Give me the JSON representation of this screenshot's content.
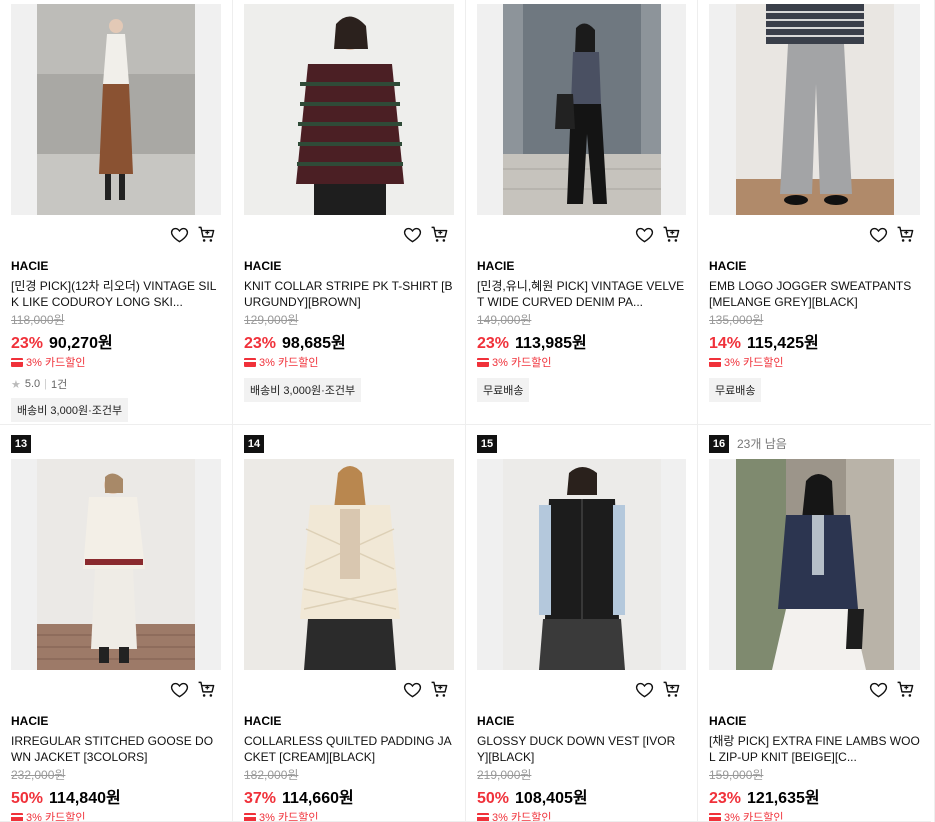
{
  "products": [
    {
      "rank": "",
      "remaining": "",
      "brand": "HACIE",
      "title": "[민경 PICK](12차 리오더) VINTAGE SILK LIKE CODUROY LONG SKI...",
      "original_price": "118,000원",
      "discount": "23%",
      "price": "90,270원",
      "card_discount": "3% 카드할인",
      "rating": "5.0",
      "reviews": "1건",
      "shipping": "배송비 3,000원·조건부"
    },
    {
      "rank": "",
      "remaining": "",
      "brand": "HACIE",
      "title": "KNIT COLLAR STRIPE PK T-SHIRT [BURGUNDY][BROWN]",
      "original_price": "129,000원",
      "discount": "23%",
      "price": "98,685원",
      "card_discount": "3% 카드할인",
      "rating": "",
      "reviews": "",
      "shipping": "배송비 3,000원·조건부"
    },
    {
      "rank": "",
      "remaining": "",
      "brand": "HACIE",
      "title": "[민경,유니,혜원 PICK] VINTAGE VELVET WIDE CURVED DENIM PA...",
      "original_price": "149,000원",
      "discount": "23%",
      "price": "113,985원",
      "card_discount": "3% 카드할인",
      "rating": "",
      "reviews": "",
      "shipping": "무료배송"
    },
    {
      "rank": "",
      "remaining": "",
      "brand": "HACIE",
      "title": "EMB LOGO JOGGER SWEATPANTS [MELANGE GREY][BLACK]",
      "original_price": "135,000원",
      "discount": "14%",
      "price": "115,425원",
      "card_discount": "3% 카드할인",
      "rating": "",
      "reviews": "",
      "shipping": "무료배송"
    },
    {
      "rank": "13",
      "remaining": "",
      "brand": "HACIE",
      "title": "IRREGULAR STITCHED GOOSE DOWN JACKET [3COLORS]",
      "original_price": "232,000원",
      "discount": "50%",
      "price": "114,840원",
      "card_discount": "3% 카드할인",
      "rating": "",
      "reviews": "",
      "shipping": ""
    },
    {
      "rank": "14",
      "remaining": "",
      "brand": "HACIE",
      "title": "COLLARLESS QUILTED PADDING JACKET [CREAM][BLACK]",
      "original_price": "182,000원",
      "discount": "37%",
      "price": "114,660원",
      "card_discount": "3% 카드할인",
      "rating": "",
      "reviews": "",
      "shipping": ""
    },
    {
      "rank": "15",
      "remaining": "",
      "brand": "HACIE",
      "title": "GLOSSY DUCK DOWN VEST [IVORY][BLACK]",
      "original_price": "219,000원",
      "discount": "50%",
      "price": "108,405원",
      "card_discount": "3% 카드할인",
      "rating": "",
      "reviews": "",
      "shipping": ""
    },
    {
      "rank": "16",
      "remaining": "23개 남음",
      "brand": "HACIE",
      "title": "[채랑 PICK] EXTRA FINE LAMBS WOOL ZIP-UP KNIT [BEIGE][C...",
      "original_price": "159,000원",
      "discount": "23%",
      "price": "121,635원",
      "card_discount": "3% 카드할인",
      "rating": "",
      "reviews": "",
      "shipping": ""
    }
  ],
  "icons": {
    "wishlist": "heart-icon",
    "cart": "cart-icon",
    "star": "star-icon"
  },
  "colors": {
    "discount": "#f0313a",
    "rank_bg": "#111111",
    "badge_bg": "#f2f2f2"
  }
}
